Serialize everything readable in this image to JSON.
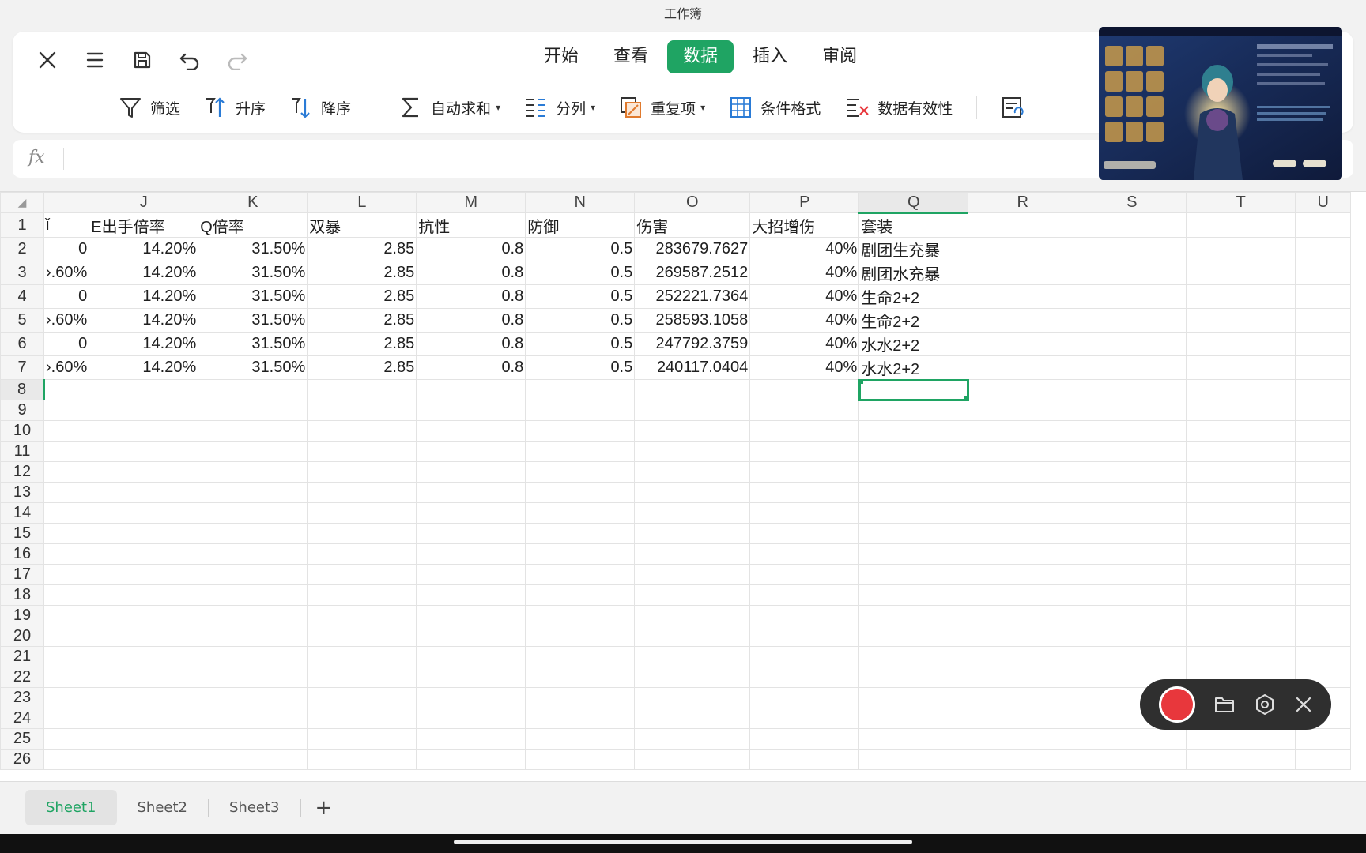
{
  "window_title": "工作簿",
  "tabs": [
    {
      "label": "开始",
      "active": false
    },
    {
      "label": "查看",
      "active": false
    },
    {
      "label": "数据",
      "active": true
    },
    {
      "label": "插入",
      "active": false
    },
    {
      "label": "审阅",
      "active": false
    }
  ],
  "ribbon": {
    "filter": "筛选",
    "sort_asc": "升序",
    "sort_desc": "降序",
    "autosum": "自动求和",
    "split": "分列",
    "duplicates": "重复项",
    "cond_format": "条件格式",
    "validation": "数据有效性"
  },
  "formula_bar": {
    "label": "fx",
    "value": ""
  },
  "grid": {
    "columns": [
      "",
      "J",
      "K",
      "L",
      "M",
      "N",
      "O",
      "P",
      "Q",
      "R",
      "S",
      "T",
      "U"
    ],
    "selected_column": "Q",
    "selected_row": 8,
    "rows": [
      [
        "ǐ",
        "E出手倍率",
        "Q倍率",
        "双暴",
        "抗性",
        "防御",
        "伤害",
        "大招增伤",
        "套装"
      ],
      [
        "0",
        "14.20%",
        "31.50%",
        "2.85",
        "0.8",
        "0.5",
        "283679.7627",
        "40%",
        "剧团生充暴"
      ],
      [
        "›.60%",
        "14.20%",
        "31.50%",
        "2.85",
        "0.8",
        "0.5",
        "269587.2512",
        "40%",
        "剧团水充暴"
      ],
      [
        "0",
        "14.20%",
        "31.50%",
        "2.85",
        "0.8",
        "0.5",
        "252221.7364",
        "40%",
        "生命2+2"
      ],
      [
        "›.60%",
        "14.20%",
        "31.50%",
        "2.85",
        "0.8",
        "0.5",
        "258593.1058",
        "40%",
        "生命2+2"
      ],
      [
        "0",
        "14.20%",
        "31.50%",
        "2.85",
        "0.8",
        "0.5",
        "247792.3759",
        "40%",
        "水水2+2"
      ],
      [
        "›.60%",
        "14.20%",
        "31.50%",
        "2.85",
        "0.8",
        "0.5",
        "240117.0404",
        "40%",
        "水水2+2"
      ]
    ],
    "row_count": 26
  },
  "sheets": [
    {
      "label": "Sheet1",
      "active": true
    },
    {
      "label": "Sheet2",
      "active": false
    },
    {
      "label": "Sheet3",
      "active": false
    }
  ],
  "add_sheet_label": "+",
  "colors": {
    "accent": "#1fa463",
    "record": "#e8373c"
  }
}
